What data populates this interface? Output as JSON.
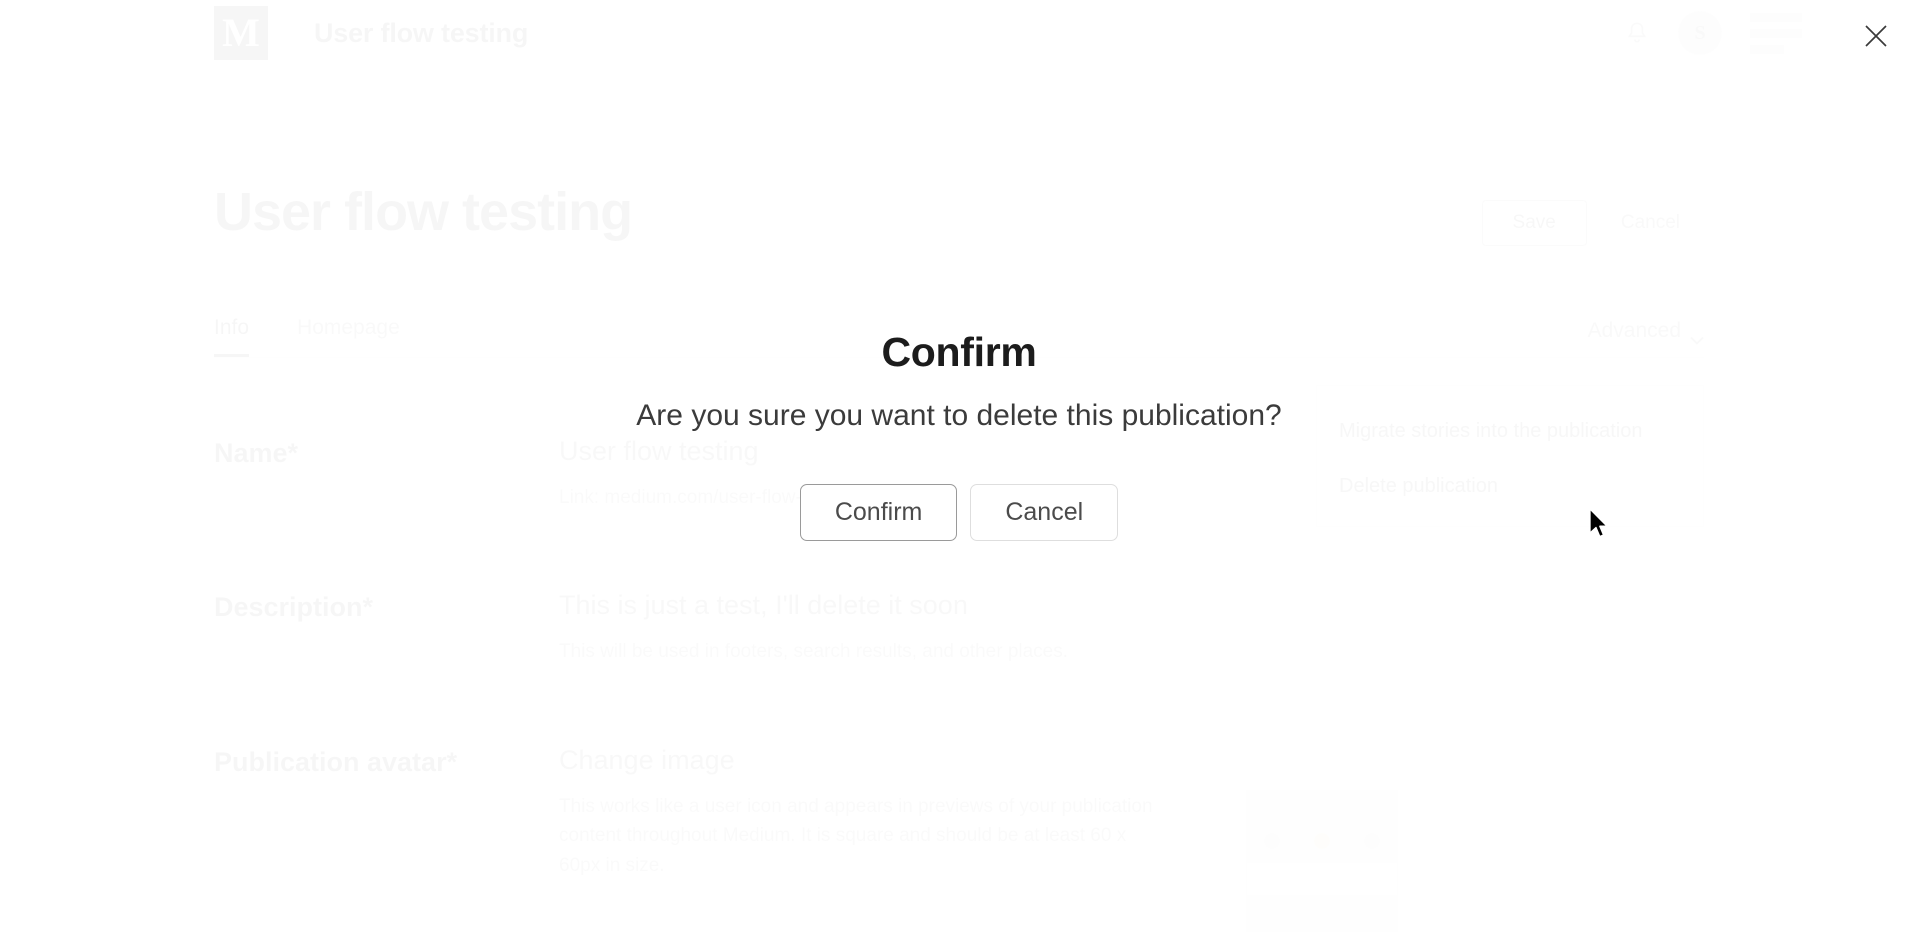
{
  "app": {
    "logo_letter": "M",
    "title": "User flow testing",
    "bell_icon": "bell-icon",
    "avatar_initial": "S",
    "write_icon": "write-icon"
  },
  "close": {
    "icon": "close-icon",
    "label": "Close"
  },
  "page": {
    "title": "User flow testing",
    "save_label": "Save",
    "cancel_label": "Cancel"
  },
  "tabs": [
    {
      "label": "Info",
      "active": true
    },
    {
      "label": "Homepage",
      "active": false
    }
  ],
  "advanced": {
    "label": "Advanced",
    "chevron_icon": "chevron-down-icon",
    "items": [
      {
        "label": "Migrate stories into the publication"
      },
      {
        "label": "Delete publication"
      }
    ]
  },
  "form": {
    "name": {
      "label": "Name*",
      "value": "User flow testing",
      "hint": "Link: medium.com/user-flow-testing"
    },
    "description": {
      "label": "Description*",
      "value": "This is just a test, I'll delete it soon",
      "hint": "This will be used in footers, search results, and other places."
    },
    "avatar": {
      "label": "Publication avatar*",
      "action": "Change image",
      "hint": "This works like a user icon and appears in previews of your publication content throughout Medium. It is square and should be at least 60 x 60px in size."
    }
  },
  "dialog": {
    "title": "Confirm",
    "message": "Are you sure you want to delete this publication?",
    "confirm_label": "Confirm",
    "cancel_label": "Cancel"
  },
  "colors": {
    "text": "#1c1c1c",
    "muted": "#8a8a8a",
    "border_strong": "#9a9a9a",
    "border_light": "#dedede",
    "background": "#ffffff"
  }
}
